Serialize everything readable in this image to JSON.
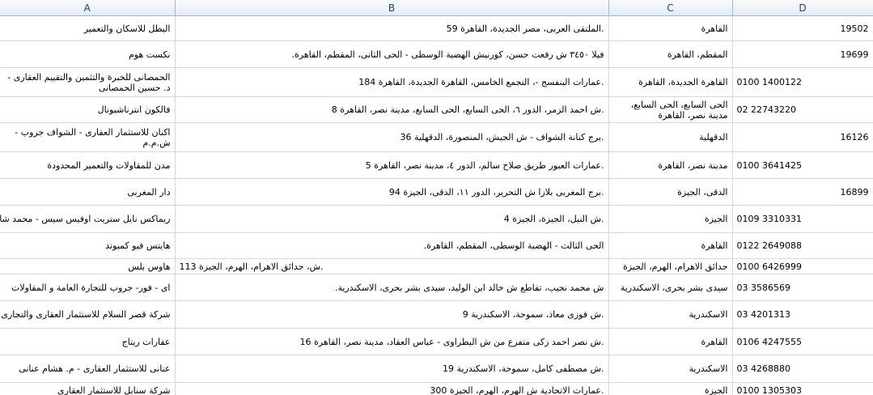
{
  "columns": [
    "A",
    "B",
    "C",
    "D"
  ],
  "rows": [
    {
      "a": "البطل للاسكان والتعمير",
      "b": ".الملتقى العربى، مصر الجديدة، القاهرة 59",
      "c": "القاهرة",
      "d_phone": "",
      "d_num": "19502"
    },
    {
      "a": "نكست هوم",
      "b": "فيلا ٣٤٥٠ ش رفعت حسن، كورنيش الهضبة الوسطى - الحى الثانى، المقطم، القاهرة.",
      "c": "المقطم، القاهرة",
      "d_phone": "",
      "d_num": "19699"
    },
    {
      "a": "الحمصانى للخبرة والتثمين والتقييم العقارى - د. حسين الحمصانى",
      "b": ".عمارات البنفسج -، التجمع الخامس، القاهرة الجديدة، القاهرة 184",
      "c": "القاهرة الجديدة، القاهرة",
      "d_phone": "0100 1400122",
      "d_num": ""
    },
    {
      "a": "فالكون انترناشيونال",
      "b": ".ش احمد الزمر، الدور ٦، الحى السابع، الحى السابع، مدينة نصر، القاهرة 8",
      "c": "الحى السابع، الحى السابع، مدينة نصر، القاهرة",
      "d_phone": "02 22743220",
      "d_num": ""
    },
    {
      "a": "اكنان للاستثمار العقارى - الشواف جروب - ش.م.م",
      "b": ".برج كنانة الشواف - ش الجيش، المنصورة، الدقهلية 36",
      "c": "الدقهلية",
      "d_phone": "",
      "d_num": "16126"
    },
    {
      "a": "مدن للمقاولات والتعمير المحدودة",
      "b": ".عمارات العبور طريق صلاح سالم، الدور ٤، مدينة نصر، القاهرة 5",
      "c": "مدينة نصر، القاهرة",
      "d_phone": "0100 3641425",
      "d_num": ""
    },
    {
      "a": "دار المغربى",
      "b": ".برج المغربى بلازا ش التحرير، الدور ١١، الدقى، الجيزة 94",
      "c": "الدقى، الجيزة",
      "d_phone": "",
      "d_num": "16899"
    },
    {
      "a": "ريماكس نايل ستريت اوفيس سيس - محمد شافعى",
      "b": ".ش النيل، الجيزة، الجيزة 4",
      "c": "الجيزة",
      "d_phone": "0109 3310331",
      "d_num": ""
    },
    {
      "a": "هايتس فيو كمبوند",
      "b": "الحى الثالث - الهضبة الوسطى، المقطم، القاهرة.",
      "c": "القاهرة",
      "d_phone": "0122 2649088",
      "d_num": ""
    },
    {
      "a": "هاوس بلس",
      "b": ".ش، حدائق الاهرام، الهرم، الجيزة 113",
      "c": "حدائق الاهرام، الهرم، الجيزة",
      "d_phone": "0100 6426999",
      "d_num": ""
    },
    {
      "a": "اى - فور- جروب للتجارة العامة و المقاولات",
      "b": "ش محمد نجيب، تقاطع ش خالد ابن الوليد، سيدى بشر بحرى، الاسكندرية.",
      "c": "سيدى بشر بحرى، الاسكندرية",
      "d_phone": "03 3586569",
      "d_num": ""
    },
    {
      "a": "شركة قصر السلام للاستثمار العقارى والتجارى",
      "b": ".ش فوزى معاذ، سموحة، الاسكندرية 9",
      "c": "الاسكندرية",
      "d_phone": "03 4201313",
      "d_num": ""
    },
    {
      "a": "عقارات ريتاج",
      "b": ".ش نصر احمد زكى متفرع من ش البطراوى - عباس العقاد، مدينة نصر، القاهرة 16",
      "c": "القاهرة",
      "d_phone": "0106 4247555",
      "d_num": ""
    },
    {
      "a": "عنانى للاستثمار العقارى - م. هشام عنانى",
      "b": ".ش مصطفى كامل، سموحة، الاسكندرية 19",
      "c": "الاسكندرية",
      "d_phone": "03 4268880",
      "d_num": ""
    },
    {
      "a": "شركة سنابل للاستثمار العقارى",
      "b": ".عمارات الاتحادية ش الهرم، الهرم، الجيزة 300",
      "c": "الجيزة",
      "d_phone": "0100 1305303",
      "d_num": ""
    }
  ]
}
